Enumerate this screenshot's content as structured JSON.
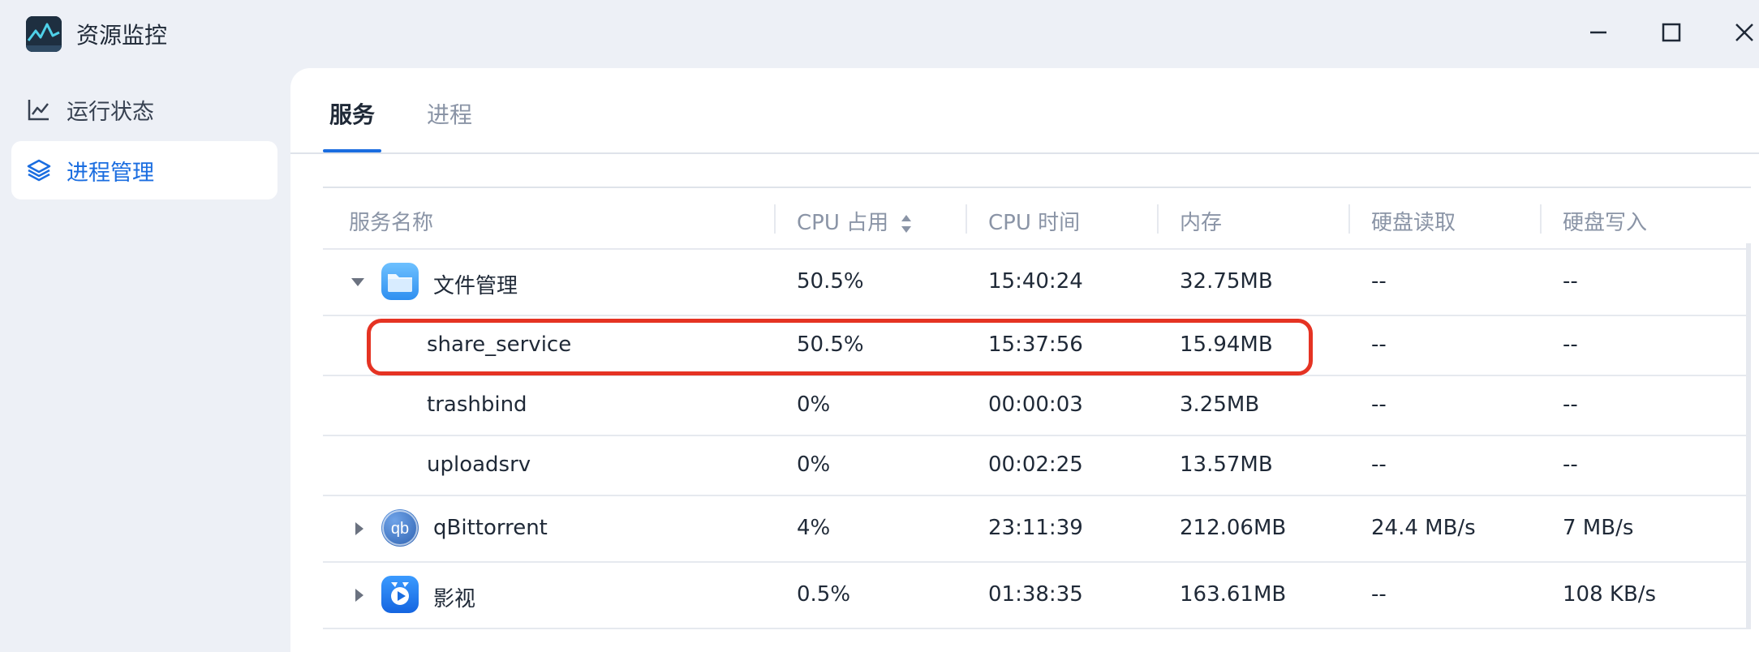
{
  "window": {
    "title": "资源监控",
    "icon": "activity-monitor-icon",
    "controls": [
      "minimize-icon",
      "maximize-icon",
      "close-icon"
    ]
  },
  "sidebar": {
    "items": [
      {
        "label": "运行状态",
        "icon": "line-chart-icon",
        "active": false
      },
      {
        "label": "进程管理",
        "icon": "layers-icon",
        "active": true
      }
    ]
  },
  "tabs": [
    {
      "label": "服务",
      "active": true
    },
    {
      "label": "进程",
      "active": false
    }
  ],
  "table": {
    "columns": [
      "服务名称",
      "CPU 占用",
      "CPU 时间",
      "内存",
      "硬盘读取",
      "硬盘写入"
    ],
    "sorted_column": "CPU 占用",
    "rows": [
      {
        "name": "文件管理",
        "cpu": "50.5%",
        "cpu_time": "15:40:24",
        "memory": "32.75MB",
        "disk_read": "--",
        "disk_write": "--",
        "expanded": true,
        "icon": "folder-icon"
      },
      {
        "name": "share_service",
        "cpu": "50.5%",
        "cpu_time": "15:37:56",
        "memory": "15.94MB",
        "disk_read": "--",
        "disk_write": "--",
        "child": true,
        "highlighted": true
      },
      {
        "name": "trashbind",
        "cpu": "0%",
        "cpu_time": "00:00:03",
        "memory": "3.25MB",
        "disk_read": "--",
        "disk_write": "--",
        "child": true
      },
      {
        "name": "uploadsrv",
        "cpu": "0%",
        "cpu_time": "00:02:25",
        "memory": "13.57MB",
        "disk_read": "--",
        "disk_write": "--",
        "child": true
      },
      {
        "name": "qBittorrent",
        "cpu": "4%",
        "cpu_time": "23:11:39",
        "memory": "212.06MB",
        "disk_read": "24.4 MB/s",
        "disk_write": "7 MB/s",
        "expanded": false,
        "icon": "qbittorrent-icon"
      },
      {
        "name": "影视",
        "cpu": "0.5%",
        "cpu_time": "01:38:35",
        "memory": "163.61MB",
        "disk_read": "--",
        "disk_write": "108 KB/s",
        "expanded": false,
        "icon": "video-app-icon"
      }
    ]
  },
  "colors": {
    "accent": "#1a6de0",
    "highlight_border": "#e53323",
    "background": "#edf0f6"
  }
}
